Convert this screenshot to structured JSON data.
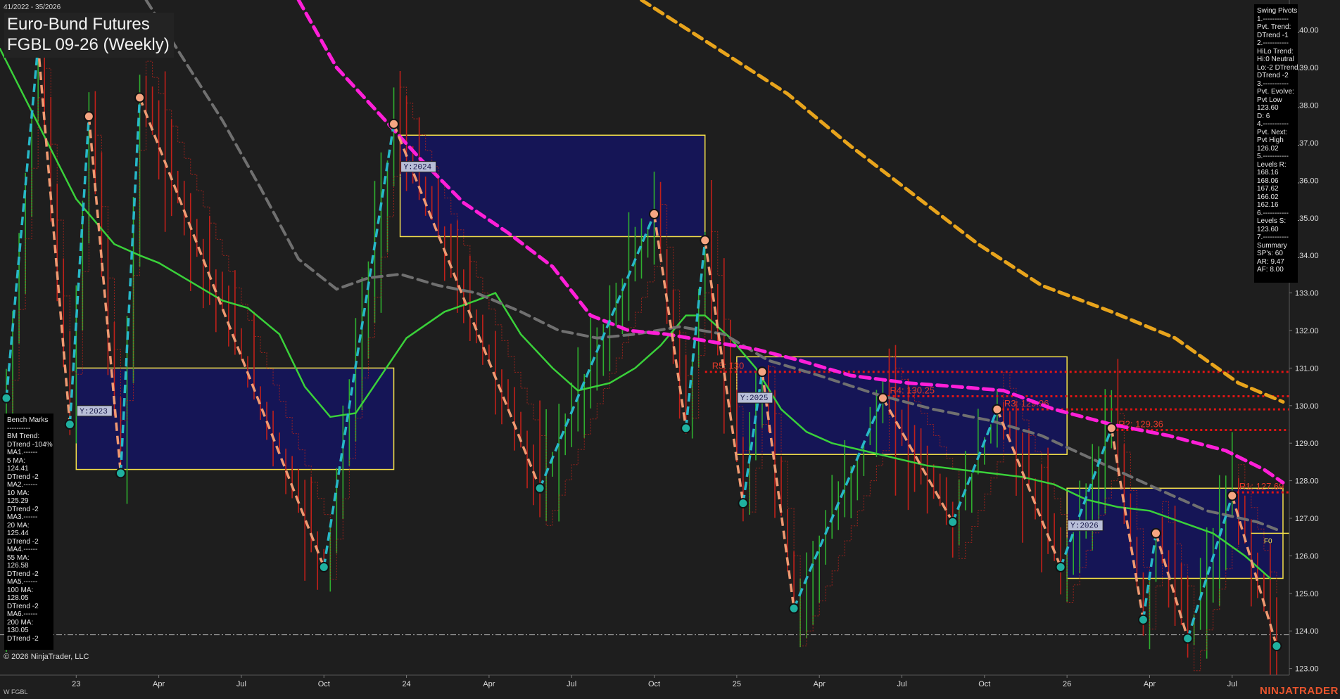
{
  "header": {
    "date_range": "41/2022 - 35/2026",
    "title": "Euro-Bund Futures",
    "subtitle": "FGBL 09-26 (Weekly)"
  },
  "footer": {
    "copyright": "© 2026 NinjaTrader, LLC",
    "symbol": "W FGBL",
    "brand": "NINJATRADER"
  },
  "swing_pivots_panel": [
    "Swing Pivots",
    "1.-----------",
    "Pvt. Trend:",
    "DTrend -1",
    "2.-----------",
    "HiLo Trend:",
    "Hi:0 Neutral",
    "Lo:-2 DTrend",
    "DTrend -2",
    "3.-----------",
    "Pvt. Evolve:",
    "Pvt Low",
    "123.60",
    "D: 6",
    "4.-----------",
    "Pvt. Next:",
    "Pvt High",
    "126.02",
    "5.-----------",
    "Levels R:",
    "168.16",
    "168.06",
    "167.62",
    "166.02",
    "162.16",
    "6.-----------",
    "Levels S:",
    "123.60",
    "7.-----------",
    "Summary",
    "SP's: 60",
    "AR: 9.47",
    "AF: 8.00"
  ],
  "bench_marks_panel": [
    "Bench Marks",
    "----------",
    "BM Trend:",
    "DTrend -104%",
    "MA1.------",
    "5 MA:",
    "124.41",
    "DTrend -2",
    "MA2.------",
    "10 MA:",
    "125.29",
    "DTrend -2",
    "MA3.------",
    "20 MA:",
    "125.44",
    "DTrend -2",
    "MA4.------",
    "55 MA:",
    "126.58",
    "DTrend -2",
    "MA5.------",
    "100 MA:",
    "128.05",
    "DTrend -2",
    "MA6.------",
    "200 MA:",
    "130.05",
    "DTrend -2"
  ],
  "chart_data": {
    "type": "line",
    "title": "Euro-Bund Futures FGBL 09-26 (Weekly)",
    "x_axis": {
      "range": [
        "2022-10-10",
        "2026-08-31"
      ],
      "ticks": [
        {
          "label": "23",
          "date": "2023-01-02"
        },
        {
          "label": "Apr",
          "date": "2023-04-03"
        },
        {
          "label": "Jul",
          "date": "2023-07-03"
        },
        {
          "label": "Oct",
          "date": "2023-10-02"
        },
        {
          "label": "24",
          "date": "2024-01-01"
        },
        {
          "label": "Apr",
          "date": "2024-04-01"
        },
        {
          "label": "Jul",
          "date": "2024-07-01"
        },
        {
          "label": "Oct",
          "date": "2024-09-30"
        },
        {
          "label": "25",
          "date": "2024-12-30"
        },
        {
          "label": "Apr",
          "date": "2025-03-31"
        },
        {
          "label": "Jul",
          "date": "2025-06-30"
        },
        {
          "label": "Oct",
          "date": "2025-09-29"
        },
        {
          "label": "26",
          "date": "2025-12-29"
        },
        {
          "label": "Apr",
          "date": "2026-03-30"
        },
        {
          "label": "Jul",
          "date": "2026-06-29"
        }
      ]
    },
    "y_axis": {
      "range": [
        122.6,
        140.8
      ],
      "ticks": [
        123,
        124,
        125,
        126,
        127,
        128,
        129,
        130,
        131,
        132,
        133,
        134,
        135,
        136,
        137,
        138,
        139,
        140
      ],
      "tick_labels": [
        "123.00",
        "124.00",
        "125.00",
        "126.00",
        "127.00",
        "128.00",
        "129.00",
        "130.00",
        "131.00",
        "132.00",
        "133.00",
        "134.00",
        "135.00",
        "136.00",
        "137.00",
        "138.00",
        "139.00",
        "140.00"
      ]
    },
    "grid": false,
    "reference_line": {
      "y": 123.9,
      "style": "dash-dot"
    },
    "swing_pivots": [
      {
        "date": "2022-10-17",
        "y": 130.2,
        "kind": "low"
      },
      {
        "date": "2022-11-21",
        "y": 139.6,
        "kind": "high"
      },
      {
        "date": "2022-12-26",
        "y": 129.5,
        "kind": "low"
      },
      {
        "date": "2023-01-16",
        "y": 137.7,
        "kind": "high"
      },
      {
        "date": "2023-02-20",
        "y": 128.2,
        "kind": "low"
      },
      {
        "date": "2023-03-13",
        "y": 138.2,
        "kind": "high"
      },
      {
        "date": "2023-10-02",
        "y": 125.7,
        "kind": "low"
      },
      {
        "date": "2023-12-18",
        "y": 137.5,
        "kind": "high"
      },
      {
        "date": "2024-05-27",
        "y": 127.8,
        "kind": "low"
      },
      {
        "date": "2024-09-30",
        "y": 135.1,
        "kind": "high"
      },
      {
        "date": "2024-11-04",
        "y": 129.4,
        "kind": "low"
      },
      {
        "date": "2024-11-25",
        "y": 134.4,
        "kind": "high"
      },
      {
        "date": "2025-01-06",
        "y": 127.4,
        "kind": "low"
      },
      {
        "date": "2025-01-27",
        "y": 130.9,
        "kind": "high"
      },
      {
        "date": "2025-03-03",
        "y": 124.6,
        "kind": "low"
      },
      {
        "date": "2025-06-09",
        "y": 130.2,
        "kind": "high"
      },
      {
        "date": "2025-08-25",
        "y": 126.9,
        "kind": "low"
      },
      {
        "date": "2025-10-13",
        "y": 129.9,
        "kind": "high"
      },
      {
        "date": "2025-12-22",
        "y": 125.7,
        "kind": "low"
      },
      {
        "date": "2026-02-16",
        "y": 129.4,
        "kind": "high"
      },
      {
        "date": "2026-03-23",
        "y": 124.3,
        "kind": "low"
      },
      {
        "date": "2026-04-06",
        "y": 126.6,
        "kind": "high"
      },
      {
        "date": "2026-05-11",
        "y": 123.8,
        "kind": "low"
      },
      {
        "date": "2026-06-29",
        "y": 127.6,
        "kind": "high"
      },
      {
        "date": "2026-08-17",
        "y": 123.6,
        "kind": "low"
      }
    ],
    "moving_averages": [
      {
        "name": "10 MA",
        "color": "#3ad13a",
        "style": "solid",
        "points": [
          [
            "2022-10-10",
            139.5
          ],
          [
            "2022-11-21",
            137.5
          ],
          [
            "2023-01-02",
            135.5
          ],
          [
            "2023-02-13",
            134.3
          ],
          [
            "2023-03-13",
            134.0
          ],
          [
            "2023-04-03",
            133.8
          ],
          [
            "2023-05-01",
            133.4
          ],
          [
            "2023-06-12",
            132.8
          ],
          [
            "2023-07-10",
            132.6
          ],
          [
            "2023-08-14",
            131.9
          ],
          [
            "2023-09-11",
            130.5
          ],
          [
            "2023-10-09",
            129.7
          ],
          [
            "2023-11-06",
            129.8
          ],
          [
            "2023-12-04",
            130.8
          ],
          [
            "2024-01-01",
            131.8
          ],
          [
            "2024-02-12",
            132.5
          ],
          [
            "2024-03-18",
            132.8
          ],
          [
            "2024-04-08",
            133.0
          ],
          [
            "2024-05-06",
            131.9
          ],
          [
            "2024-06-10",
            131.0
          ],
          [
            "2024-07-08",
            130.4
          ],
          [
            "2024-08-12",
            130.6
          ],
          [
            "2024-09-09",
            131.0
          ],
          [
            "2024-10-07",
            131.6
          ],
          [
            "2024-11-04",
            132.4
          ],
          [
            "2024-11-25",
            132.4
          ],
          [
            "2024-12-23",
            131.8
          ],
          [
            "2025-01-20",
            131.0
          ],
          [
            "2025-02-17",
            129.9
          ],
          [
            "2025-03-17",
            129.3
          ],
          [
            "2025-04-14",
            129.0
          ],
          [
            "2025-05-19",
            128.8
          ],
          [
            "2025-06-23",
            128.6
          ],
          [
            "2025-07-28",
            128.4
          ],
          [
            "2025-09-01",
            128.3
          ],
          [
            "2025-10-06",
            128.2
          ],
          [
            "2025-11-10",
            128.1
          ],
          [
            "2025-12-15",
            127.9
          ],
          [
            "2026-01-19",
            127.5
          ],
          [
            "2026-02-23",
            127.3
          ],
          [
            "2026-03-30",
            127.2
          ],
          [
            "2026-05-04",
            126.9
          ],
          [
            "2026-06-08",
            126.6
          ],
          [
            "2026-07-13",
            126.0
          ],
          [
            "2026-08-10",
            125.4
          ]
        ]
      },
      {
        "name": "55 MA",
        "color": "#707070",
        "style": "dashed",
        "points": [
          [
            "2023-03-20",
            140.8
          ],
          [
            "2023-05-01",
            139.2
          ],
          [
            "2023-06-12",
            137.6
          ],
          [
            "2023-07-24",
            135.8
          ],
          [
            "2023-09-04",
            133.9
          ],
          [
            "2023-10-16",
            133.1
          ],
          [
            "2023-11-20",
            133.4
          ],
          [
            "2023-12-25",
            133.5
          ],
          [
            "2024-02-05",
            133.2
          ],
          [
            "2024-03-18",
            133.0
          ],
          [
            "2024-05-06",
            132.5
          ],
          [
            "2024-06-17",
            132.0
          ],
          [
            "2024-07-29",
            131.8
          ],
          [
            "2024-09-09",
            131.9
          ],
          [
            "2024-10-28",
            132.1
          ],
          [
            "2024-12-16",
            131.9
          ],
          [
            "2025-02-03",
            131.2
          ],
          [
            "2025-03-31",
            130.8
          ],
          [
            "2025-06-02",
            130.3
          ],
          [
            "2025-08-04",
            129.9
          ],
          [
            "2025-10-06",
            129.6
          ],
          [
            "2025-12-01",
            129.2
          ],
          [
            "2026-02-02",
            128.5
          ],
          [
            "2026-04-06",
            127.8
          ],
          [
            "2026-06-01",
            127.2
          ],
          [
            "2026-07-27",
            126.9
          ],
          [
            "2026-08-17",
            126.7
          ]
        ]
      },
      {
        "name": "100 MA",
        "color": "#ff1fd8",
        "style": "dashed",
        "points": [
          [
            "2023-09-04",
            140.8
          ],
          [
            "2023-10-16",
            139.0
          ],
          [
            "2023-11-27",
            137.9
          ],
          [
            "2024-01-15",
            136.6
          ],
          [
            "2024-03-04",
            135.4
          ],
          [
            "2024-04-22",
            134.6
          ],
          [
            "2024-06-10",
            133.7
          ],
          [
            "2024-07-22",
            132.4
          ],
          [
            "2024-09-02",
            132.0
          ],
          [
            "2024-10-14",
            131.9
          ],
          [
            "2024-12-02",
            131.7
          ],
          [
            "2025-01-20",
            131.5
          ],
          [
            "2025-03-10",
            131.2
          ],
          [
            "2025-05-05",
            130.8
          ],
          [
            "2025-07-07",
            130.6
          ],
          [
            "2025-09-01",
            130.5
          ],
          [
            "2025-10-20",
            130.4
          ],
          [
            "2025-12-15",
            129.9
          ],
          [
            "2026-02-16",
            129.5
          ],
          [
            "2026-04-20",
            129.2
          ],
          [
            "2026-06-22",
            128.8
          ],
          [
            "2026-08-03",
            128.3
          ],
          [
            "2026-08-24",
            127.95
          ]
        ]
      },
      {
        "name": "200 MA",
        "color": "#e8a41c",
        "style": "dashed",
        "points": [
          [
            "2024-09-16",
            140.8
          ],
          [
            "2024-12-09",
            139.5
          ],
          [
            "2025-02-24",
            138.3
          ],
          [
            "2025-05-05",
            136.9
          ],
          [
            "2025-07-14",
            135.6
          ],
          [
            "2025-09-22",
            134.3
          ],
          [
            "2025-12-01",
            133.2
          ],
          [
            "2026-02-16",
            132.5
          ],
          [
            "2026-04-27",
            131.8
          ],
          [
            "2026-07-06",
            130.6
          ],
          [
            "2026-08-24",
            130.1
          ]
        ]
      }
    ],
    "resistance_levels": [
      {
        "label": "R5: 130",
        "y": 130.9,
        "start": "2024-11-25"
      },
      {
        "label": "R4: 130.25",
        "y": 130.25,
        "start": "2025-06-09"
      },
      {
        "label": "R3: 129.96",
        "y": 129.9,
        "start": "2025-10-13"
      },
      {
        "label": "R2: 129.36",
        "y": 129.35,
        "start": "2026-02-16"
      },
      {
        "label": "R1: 127.69",
        "y": 127.69,
        "start": "2026-06-29"
      }
    ],
    "yearly_boxes": [
      {
        "label": "Y:2023",
        "x_start": "2023-01-02",
        "x_end": "2023-12-18",
        "y_low": 128.3,
        "y_high": 131.0
      },
      {
        "label": "Y:2024",
        "x_start": "2023-12-25",
        "x_end": "2024-11-25",
        "y_low": 134.5,
        "y_high": 137.2
      },
      {
        "label": "Y:2025",
        "x_start": "2024-12-30",
        "x_end": "2025-12-29",
        "y_low": 128.7,
        "y_high": 131.3
      },
      {
        "label": "Y:2026",
        "x_start": "2025-12-29",
        "x_end": "2026-08-24",
        "y_low": 125.4,
        "y_high": 127.8
      }
    ],
    "current_price_marker": {
      "label": "F0",
      "y": 126.6,
      "date": "2026-08-24"
    }
  }
}
